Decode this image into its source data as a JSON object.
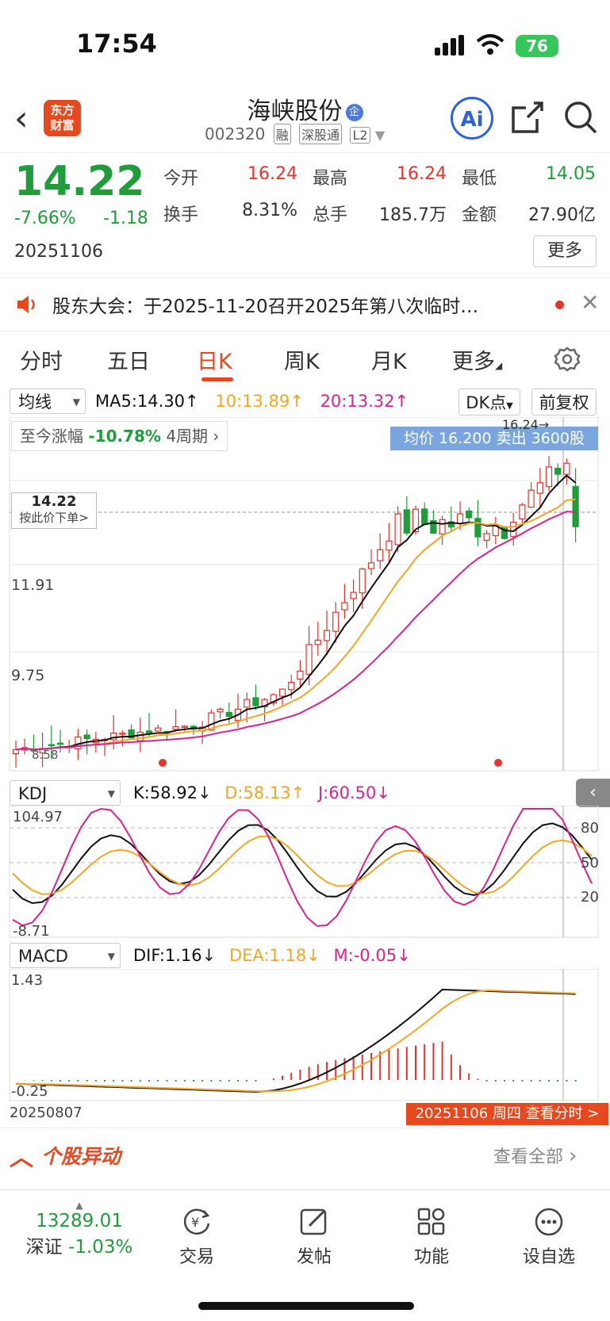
{
  "status": {
    "time": "17:54",
    "battery": "76"
  },
  "header": {
    "logo": "东方\n财富",
    "name": "海峡股份",
    "qi_badge": "企",
    "code": "002320",
    "tags": [
      "融",
      "深股通",
      "L2"
    ],
    "ai_label": "Ai"
  },
  "quote": {
    "price": "14.22",
    "change_pct": "-7.66%",
    "change": "-1.18",
    "date": "20251106",
    "open_label": "今开",
    "open": "16.24",
    "high_label": "最高",
    "high": "16.24",
    "low_label": "最低",
    "low": "14.05",
    "turnover_label": "换手",
    "turnover": "8.31%",
    "volume_label": "总手",
    "volume": "185.7万",
    "amount_label": "金额",
    "amount": "27.90亿",
    "more_label": "更多"
  },
  "notice": {
    "text": "股东大会：于2025-11-20召开2025年第八次临时…"
  },
  "tabs": [
    "分时",
    "五日",
    "日K",
    "周K",
    "月K",
    "更多"
  ],
  "chart": {
    "ma_select": "均线",
    "ma5": "MA5:14.30",
    "ma10": "10:13.89",
    "ma20": "20:13.32",
    "dk_label": "DK点",
    "fq_label": "前复权",
    "range_label": "至今涨幅",
    "range_value": "-10.78%",
    "range_period": "4周期",
    "avg_tip": "均价 16.200  卖出 3600股",
    "max_label": "16.24→",
    "price_tag": "14.22",
    "price_tag_sub": "按此价下单>",
    "y_labels": [
      "11.91",
      "9.75"
    ],
    "min_label": "8.58",
    "colors": {
      "up": "#e8332a",
      "down": "#1f9d3a",
      "ma5": "#111111",
      "ma10": "#f5a623",
      "ma20": "#e0208c"
    }
  },
  "kdj": {
    "select": "KDJ",
    "k": "K:58.92",
    "d": "D:58.13",
    "j": "J:60.50",
    "top": "104.97",
    "bottom": "-8.71",
    "levels": [
      "80",
      "50",
      "20"
    ]
  },
  "macd": {
    "select": "MACD",
    "dif": "DIF:1.16",
    "dea": "DEA:1.18",
    "m": "M:-0.05",
    "top": "1.43",
    "bottom": "-0.25",
    "start_date": "20250807",
    "end_tip": "20251106 周四 查看分时 >"
  },
  "movement": {
    "title": "个股异动",
    "link": "查看全部"
  },
  "nav": {
    "index_value": "13289.01",
    "index_name": "深证",
    "index_change": "-1.03%",
    "items": [
      "交易",
      "发帖",
      "功能",
      "设自选"
    ]
  }
}
